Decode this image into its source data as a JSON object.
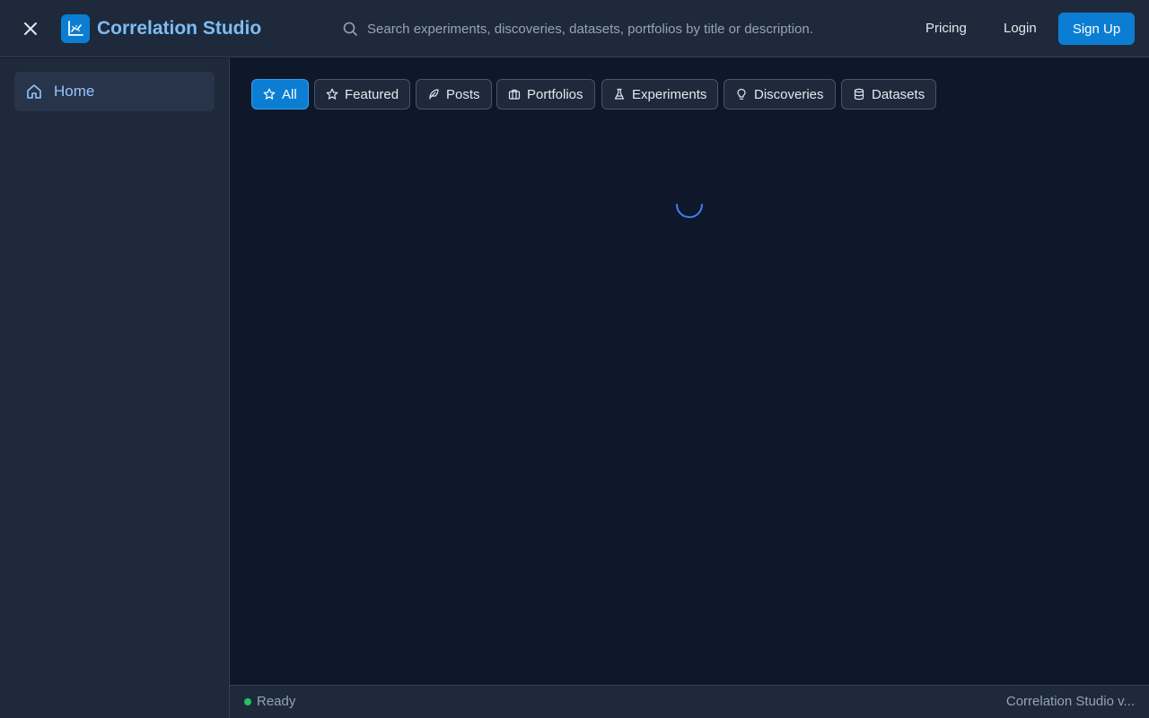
{
  "header": {
    "app_title": "Correlation Studio",
    "search": {
      "placeholder": "Search experiments, discoveries, datasets, portfolios by title or description."
    },
    "pricing_label": "Pricing",
    "login_label": "Login",
    "signup_label": "Sign Up",
    "icons": [
      "close-icon",
      "chart-logo-icon",
      "search-icon"
    ]
  },
  "sidebar": {
    "items": [
      {
        "label": "Home",
        "icon": "home-icon",
        "active": true
      }
    ]
  },
  "filters": {
    "tabs": [
      {
        "label": "All",
        "icon": "star-icon",
        "active": true
      },
      {
        "label": "Featured",
        "icon": "star-outline-icon",
        "active": false
      },
      {
        "label": "Posts",
        "icon": "feather-icon",
        "active": false
      },
      {
        "label": "Portfolios",
        "icon": "briefcase-icon",
        "active": false
      },
      {
        "label": "Experiments",
        "icon": "flask-icon",
        "active": false
      },
      {
        "label": "Discoveries",
        "icon": "lightbulb-icon",
        "active": false
      },
      {
        "label": "Datasets",
        "icon": "database-icon",
        "active": false
      }
    ]
  },
  "main": {
    "loading": true
  },
  "status": {
    "text": "Ready",
    "version_text": "Correlation Studio v..."
  },
  "colors": {
    "background": "#0f172a",
    "panel": "#1e293b",
    "accent": "#0b7ed4",
    "title": "#7dbcf5",
    "status_ok": "#22c55e"
  }
}
